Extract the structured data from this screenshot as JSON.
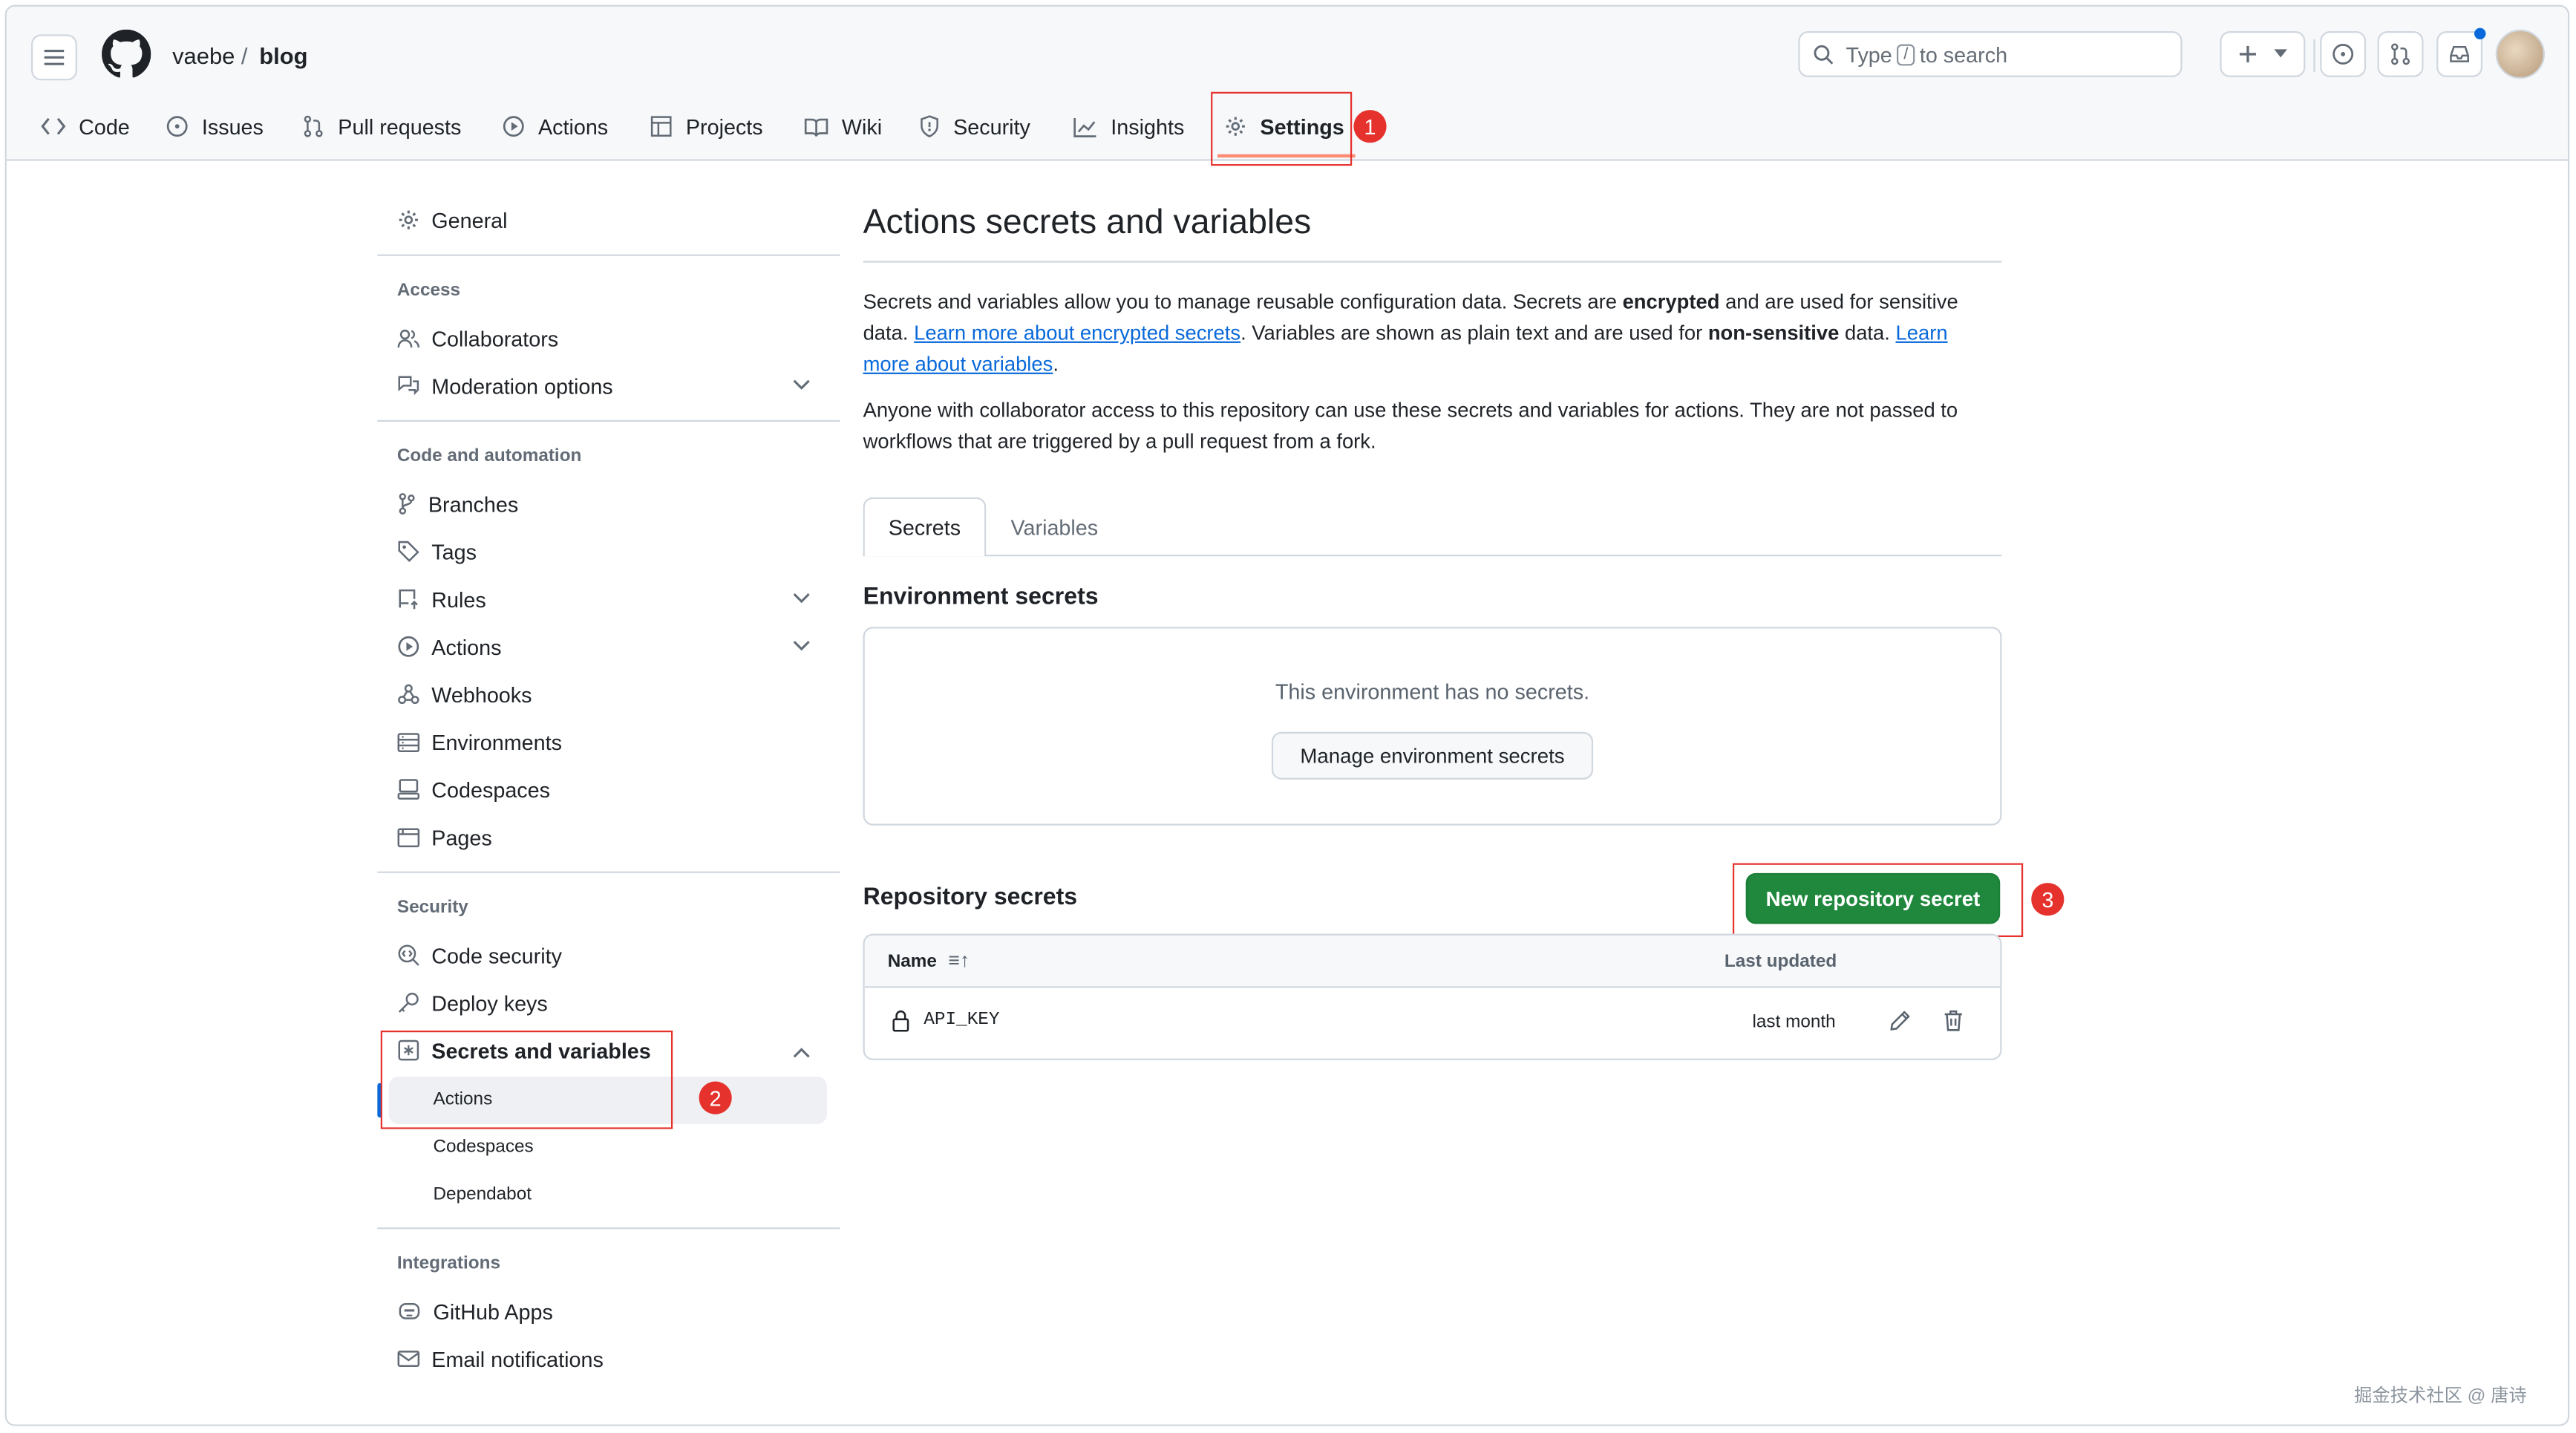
{
  "header": {
    "owner": "vaebe",
    "separator": "/",
    "repo": "blog",
    "search": {
      "prefix": "Type",
      "key": "/",
      "suffix": "to search"
    }
  },
  "tabs": [
    {
      "label": "Code",
      "icon": "code-icon"
    },
    {
      "label": "Issues",
      "icon": "issue-icon"
    },
    {
      "label": "Pull requests",
      "icon": "pull-request-icon"
    },
    {
      "label": "Actions",
      "icon": "play-icon"
    },
    {
      "label": "Projects",
      "icon": "table-icon"
    },
    {
      "label": "Wiki",
      "icon": "book-icon"
    },
    {
      "label": "Security",
      "icon": "shield-icon"
    },
    {
      "label": "Insights",
      "icon": "graph-icon"
    },
    {
      "label": "Settings",
      "icon": "gear-icon",
      "selected": true
    }
  ],
  "markers": [
    "1",
    "2",
    "3"
  ],
  "sidebar": {
    "general": "General",
    "access": {
      "heading": "Access",
      "items": [
        "Collaborators",
        "Moderation options"
      ]
    },
    "code": {
      "heading": "Code and automation",
      "items": [
        "Branches",
        "Tags",
        "Rules",
        "Actions",
        "Webhooks",
        "Environments",
        "Codespaces",
        "Pages"
      ]
    },
    "security": {
      "heading": "Security",
      "items": [
        "Code security",
        "Deploy keys",
        "Secrets and variables"
      ],
      "subitems": [
        "Actions",
        "Codespaces",
        "Dependabot"
      ]
    },
    "integrations": {
      "heading": "Integrations",
      "items": [
        "GitHub Apps",
        "Email notifications"
      ]
    }
  },
  "main": {
    "title": "Actions secrets and variables",
    "intro": {
      "p1_a": "Secrets and variables allow you to manage reusable configuration data. Secrets are ",
      "p1_b": "encrypted",
      "p1_c": " and are used for sensitive data. ",
      "link1": "Learn more about encrypted secrets",
      "p1_d": ". Variables are shown as plain text and are used for ",
      "p1_e": "non-sensitive",
      "p1_f": " data. ",
      "link2": "Learn more about variables",
      "p1_g": ".",
      "p2": "Anyone with collaborator access to this repository can use these secrets and variables for actions. They are not passed to workflows that are triggered by a pull request from a fork."
    },
    "subtabs": [
      "Secrets",
      "Variables"
    ],
    "env": {
      "heading": "Environment secrets",
      "empty": "This environment has no secrets.",
      "button": "Manage environment secrets"
    },
    "repo": {
      "heading": "Repository secrets",
      "new_button": "New repository secret",
      "columns": {
        "name": "Name",
        "sort": "≡↑",
        "updated": "Last updated"
      },
      "rows": [
        {
          "name": "API_KEY",
          "updated": "last month"
        }
      ]
    }
  },
  "watermark": "掘金技术社区 @ 唐诗",
  "colors": {
    "accent": "#0969da",
    "green": "#1f883d",
    "marker": "#e5322d",
    "tab_underline": "#fd8c73"
  }
}
